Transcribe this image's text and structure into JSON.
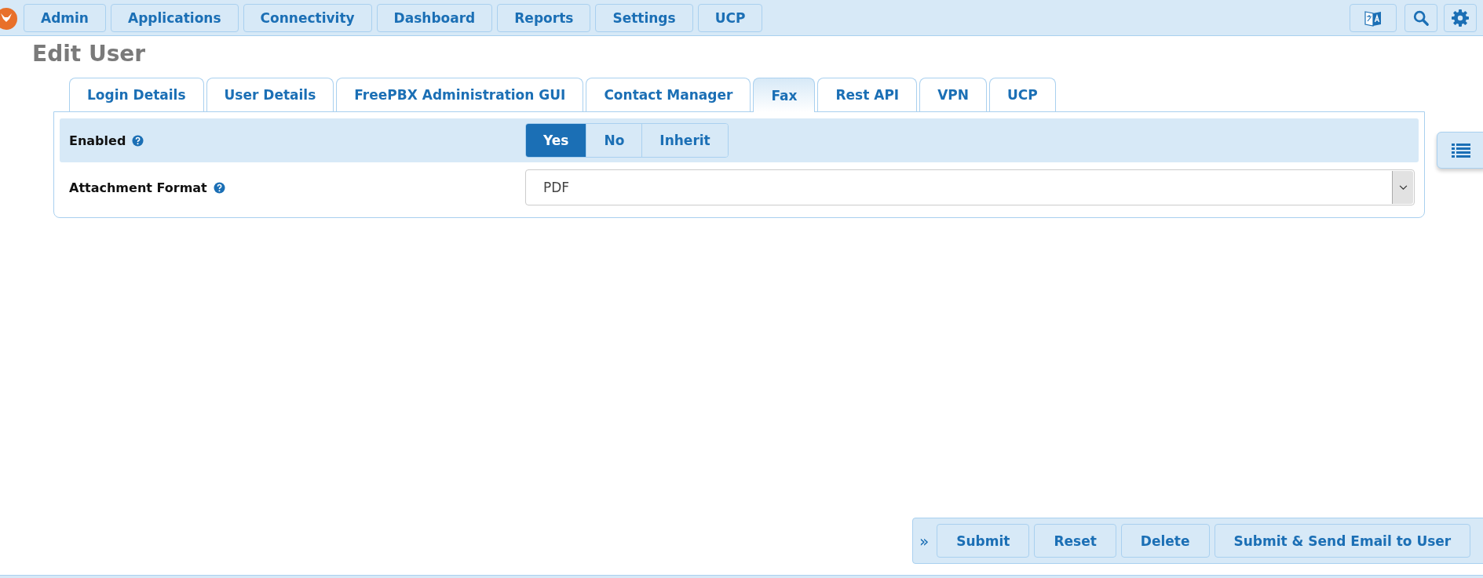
{
  "nav": {
    "items": [
      "Admin",
      "Applications",
      "Connectivity",
      "Dashboard",
      "Reports",
      "Settings",
      "UCP"
    ]
  },
  "page_title": "Edit User",
  "tabs": [
    {
      "label": "Login Details",
      "selected": false
    },
    {
      "label": "User Details",
      "selected": false
    },
    {
      "label": "FreePBX Administration GUI",
      "selected": false
    },
    {
      "label": "Contact Manager",
      "selected": false
    },
    {
      "label": "Fax",
      "selected": true
    },
    {
      "label": "Rest API",
      "selected": false
    },
    {
      "label": "VPN",
      "selected": false
    },
    {
      "label": "UCP",
      "selected": false
    }
  ],
  "form": [
    {
      "kind": "toggle",
      "label": "Enabled",
      "options": [
        {
          "label": "Yes",
          "selected": true
        },
        {
          "label": "No",
          "selected": false
        },
        {
          "label": "Inherit",
          "selected": false
        }
      ]
    },
    {
      "kind": "select",
      "label": "Attachment Format",
      "value": "PDF"
    }
  ],
  "footer": {
    "expand_icon": "»",
    "buttons": [
      "Submit",
      "Reset",
      "Delete",
      "Submit & Send Email to User"
    ]
  }
}
